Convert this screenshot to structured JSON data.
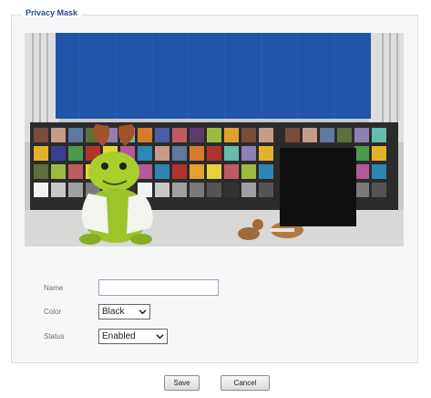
{
  "panel": {
    "title": "Privacy Mask"
  },
  "form": {
    "name_label": "Name",
    "name_value": "",
    "color_label": "Color",
    "color_value": "Black",
    "status_label": "Status",
    "status_value": "Enabled"
  },
  "actions": {
    "save_label": "Save",
    "cancel_label": "Cancel"
  },
  "preview": {
    "mask_color": "#101010",
    "background_blue": "#1f54a8"
  }
}
